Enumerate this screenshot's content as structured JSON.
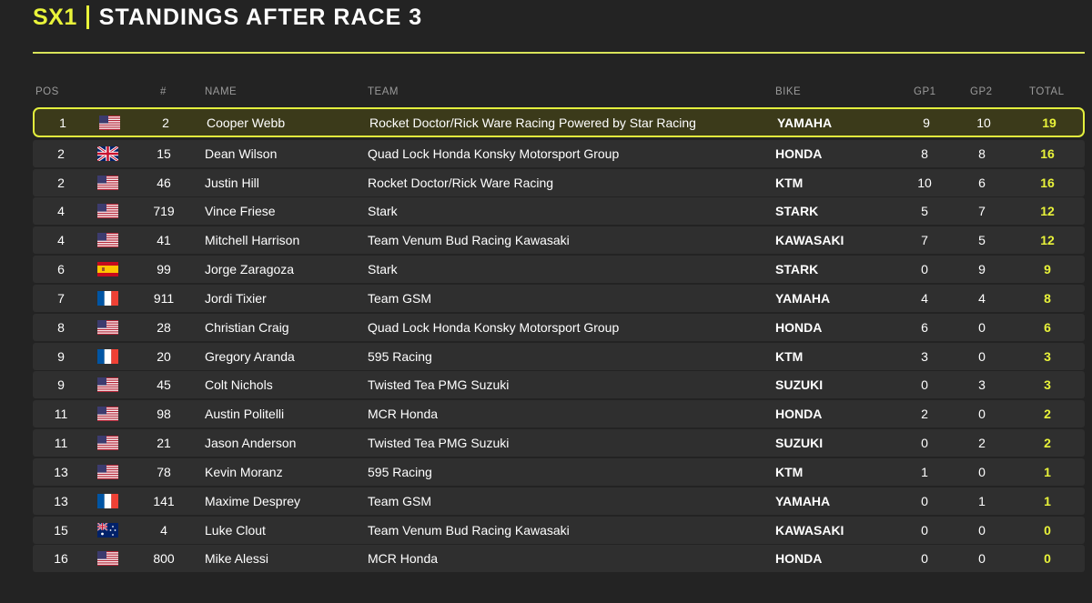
{
  "header": {
    "series": "SX1",
    "title": "STANDINGS AFTER RACE 3"
  },
  "columns": {
    "pos": "POS",
    "num": "#",
    "name": "NAME",
    "team": "TEAM",
    "bike": "BIKE",
    "gp1": "GP1",
    "gp2": "GP2",
    "total": "TOTAL"
  },
  "colors": {
    "accent": "#e9f33a",
    "background": "#232323",
    "row": "#2f2f2f"
  },
  "rows": [
    {
      "pos": "1",
      "flag": "us-flag-icon",
      "num": "2",
      "name": "Cooper Webb",
      "team": "Rocket Doctor/Rick Ware Racing Powered by Star Racing",
      "bike": "YAMAHA",
      "gp1": "9",
      "gp2": "10",
      "total": "19"
    },
    {
      "pos": "2",
      "flag": "uk-flag-icon",
      "num": "15",
      "name": "Dean Wilson",
      "team": "Quad Lock Honda Konsky Motorsport Group",
      "bike": "HONDA",
      "gp1": "8",
      "gp2": "8",
      "total": "16"
    },
    {
      "pos": "2",
      "flag": "us-flag-icon",
      "num": "46",
      "name": "Justin Hill",
      "team": "Rocket Doctor/Rick Ware Racing",
      "bike": "KTM",
      "gp1": "10",
      "gp2": "6",
      "total": "16"
    },
    {
      "pos": "4",
      "flag": "us-flag-icon",
      "num": "719",
      "name": "Vince Friese",
      "team": "Stark",
      "bike": "STARK",
      "gp1": "5",
      "gp2": "7",
      "total": "12"
    },
    {
      "pos": "4",
      "flag": "us-flag-icon",
      "num": "41",
      "name": "Mitchell Harrison",
      "team": "Team Venum Bud Racing Kawasaki",
      "bike": "KAWASAKI",
      "gp1": "7",
      "gp2": "5",
      "total": "12"
    },
    {
      "pos": "6",
      "flag": "es-flag-icon",
      "num": "99",
      "name": "Jorge Zaragoza",
      "team": "Stark",
      "bike": "STARK",
      "gp1": "0",
      "gp2": "9",
      "total": "9"
    },
    {
      "pos": "7",
      "flag": "fr-flag-icon",
      "num": "911",
      "name": "Jordi Tixier",
      "team": "Team GSM",
      "bike": "YAMAHA",
      "gp1": "4",
      "gp2": "4",
      "total": "8"
    },
    {
      "pos": "8",
      "flag": "us-flag-icon",
      "num": "28",
      "name": "Christian Craig",
      "team": "Quad Lock Honda Konsky Motorsport Group",
      "bike": "HONDA",
      "gp1": "6",
      "gp2": "0",
      "total": "6"
    },
    {
      "pos": "9",
      "flag": "fr-flag-icon",
      "num": "20",
      "name": "Gregory Aranda",
      "team": "595 Racing",
      "bike": "KTM",
      "gp1": "3",
      "gp2": "0",
      "total": "3"
    },
    {
      "pos": "9",
      "flag": "us-flag-icon",
      "num": "45",
      "name": "Colt Nichols",
      "team": "Twisted Tea PMG Suzuki",
      "bike": "SUZUKI",
      "gp1": "0",
      "gp2": "3",
      "total": "3"
    },
    {
      "pos": "11",
      "flag": "us-flag-icon",
      "num": "98",
      "name": "Austin Politelli",
      "team": "MCR Honda",
      "bike": "HONDA",
      "gp1": "2",
      "gp2": "0",
      "total": "2"
    },
    {
      "pos": "11",
      "flag": "us-flag-icon",
      "num": "21",
      "name": "Jason Anderson",
      "team": "Twisted Tea PMG Suzuki",
      "bike": "SUZUKI",
      "gp1": "0",
      "gp2": "2",
      "total": "2"
    },
    {
      "pos": "13",
      "flag": "us-flag-icon",
      "num": "78",
      "name": "Kevin Moranz",
      "team": "595 Racing",
      "bike": "KTM",
      "gp1": "1",
      "gp2": "0",
      "total": "1"
    },
    {
      "pos": "13",
      "flag": "fr-flag-icon",
      "num": "141",
      "name": "Maxime Desprey",
      "team": "Team GSM",
      "bike": "YAMAHA",
      "gp1": "0",
      "gp2": "1",
      "total": "1"
    },
    {
      "pos": "15",
      "flag": "au-flag-icon",
      "num": "4",
      "name": "Luke Clout",
      "team": "Team Venum Bud Racing Kawasaki",
      "bike": "KAWASAKI",
      "gp1": "0",
      "gp2": "0",
      "total": "0"
    },
    {
      "pos": "16",
      "flag": "us-flag-icon",
      "num": "800",
      "name": "Mike Alessi",
      "team": "MCR Honda",
      "bike": "HONDA",
      "gp1": "0",
      "gp2": "0",
      "total": "0"
    }
  ]
}
